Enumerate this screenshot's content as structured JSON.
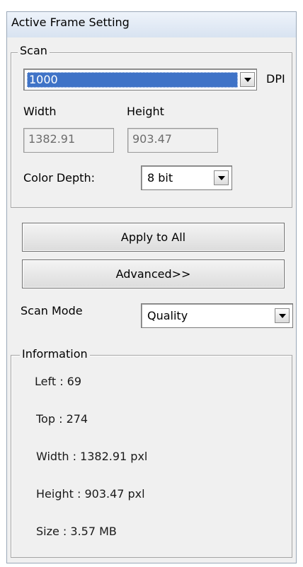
{
  "panel": {
    "title": "Active Frame Setting"
  },
  "scan": {
    "legend": "Scan",
    "dpi_value": "1000",
    "dpi_unit": "DPI",
    "width_label": "Width",
    "height_label": "Height",
    "width_value": "1382.91",
    "height_value": "903.47",
    "color_depth_label": "Color Depth:",
    "color_depth_value": "8 bit"
  },
  "buttons": {
    "apply_all": "Apply to All",
    "advanced": "Advanced>>"
  },
  "scan_mode": {
    "label": "Scan Mode",
    "value": "Quality"
  },
  "information": {
    "legend": "Information",
    "left": "Left : 69",
    "top": "Top : 274",
    "width": "Width : 1382.91 pxl",
    "height": "Height : 903.47 pxl",
    "size": "Size : 3.57 MB"
  },
  "colors": {
    "selection": "#3f73c7",
    "title_gradient_top": "#eef3fa",
    "title_gradient_bottom": "#d8e3f1",
    "panel_bg": "#f0f0f0"
  }
}
